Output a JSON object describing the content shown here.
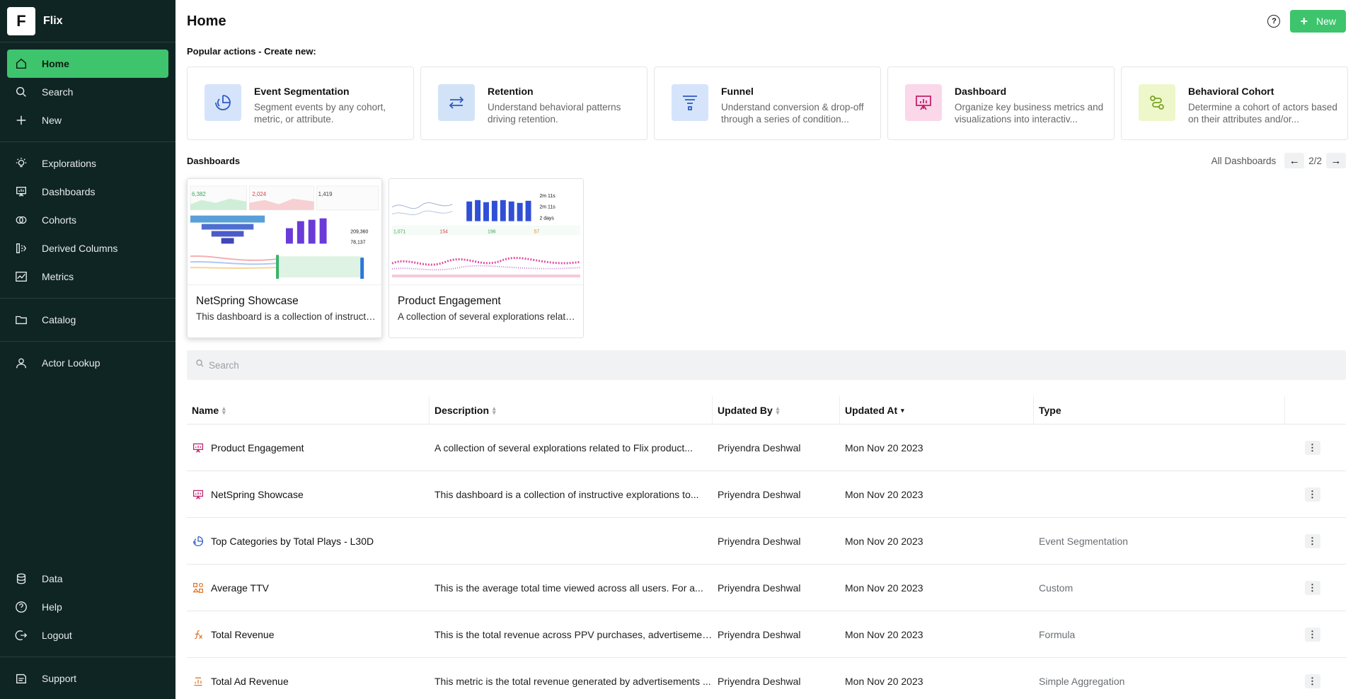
{
  "app": {
    "logo_letter": "F",
    "name": "Flix"
  },
  "sidebar": {
    "primary": [
      {
        "label": "Home",
        "icon": "home-icon",
        "active": true
      },
      {
        "label": "Search",
        "icon": "search-icon"
      },
      {
        "label": "New",
        "icon": "plus-icon"
      }
    ],
    "sections": [
      {
        "label": "Explorations",
        "icon": "lightbulb-icon"
      },
      {
        "label": "Dashboards",
        "icon": "dashboard-icon"
      },
      {
        "label": "Cohorts",
        "icon": "cohorts-icon"
      },
      {
        "label": "Derived Columns",
        "icon": "derived-columns-icon"
      },
      {
        "label": "Metrics",
        "icon": "metrics-icon"
      }
    ],
    "catalog": {
      "label": "Catalog",
      "icon": "folder-icon"
    },
    "actor_lookup": {
      "label": "Actor Lookup",
      "icon": "user-icon"
    },
    "bottom": [
      {
        "label": "Data",
        "icon": "database-icon"
      },
      {
        "label": "Help",
        "icon": "help-icon"
      },
      {
        "label": "Logout",
        "icon": "logout-icon"
      }
    ],
    "support": {
      "label": "Support",
      "icon": "support-icon"
    }
  },
  "header": {
    "title": "Home",
    "help_icon": "?",
    "new_button": "New",
    "new_icon": "+"
  },
  "popular": {
    "label": "Popular actions - Create new:",
    "cards": [
      {
        "title": "Event Segmentation",
        "desc": "Segment events by any cohort, metric, or attribute.",
        "color": "#d6e4fb"
      },
      {
        "title": "Retention",
        "desc": "Understand behavioral patterns driving retention.",
        "color": "#d3e3f7"
      },
      {
        "title": "Funnel",
        "desc": "Understand conversion & drop-off through a series of condition...",
        "color": "#d6e4fb"
      },
      {
        "title": "Dashboard",
        "desc": "Organize key business metrics and visualizations into interactiv...",
        "color": "#fbd7ea"
      },
      {
        "title": "Behavioral Cohort",
        "desc": "Determine a cohort of actors based on their attributes and/or...",
        "color": "#eef7c9"
      }
    ]
  },
  "dashboards": {
    "label": "Dashboards",
    "all_link": "All Dashboards",
    "pager": "2/2",
    "prev": "←",
    "next": "→",
    "cards": [
      {
        "title": "NetSpring Showcase",
        "desc": "This dashboard is a collection of instructive explorations to..."
      },
      {
        "title": "Product Engagement",
        "desc": "A collection of several explorations related to Flix product..."
      }
    ],
    "thumb_numbers": {
      "first": [
        "6,382",
        "2,024",
        "1,419",
        "209,360",
        "78,137"
      ],
      "second": [
        "2m 11s",
        "2m 11s",
        "2 days",
        "1,071",
        "154",
        "196",
        "57"
      ]
    }
  },
  "search": {
    "placeholder": "Search"
  },
  "table": {
    "columns": [
      "Name",
      "Description",
      "Updated By",
      "Updated At",
      "Type"
    ],
    "rows": [
      {
        "name": "Product Engagement",
        "icon": "dashboard-icon",
        "desc": "A collection of several explorations related to Flix product...",
        "by": "Priyendra Deshwal",
        "at": "Mon Nov 20 2023",
        "type": ""
      },
      {
        "name": "NetSpring Showcase",
        "icon": "dashboard-icon",
        "desc": "This dashboard is a collection of instructive explorations to...",
        "by": "Priyendra Deshwal",
        "at": "Mon Nov 20 2023",
        "type": ""
      },
      {
        "name": "Top Categories by Total Plays - L30D",
        "icon": "event-segmentation-icon",
        "desc": "",
        "by": "Priyendra Deshwal",
        "at": "Mon Nov 20 2023",
        "type": "Event Segmentation"
      },
      {
        "name": "Average TTV",
        "icon": "custom-metric-icon",
        "desc": "This is the average total time viewed across all users. For a...",
        "by": "Priyendra Deshwal",
        "at": "Mon Nov 20 2023",
        "type": "Custom"
      },
      {
        "name": "Total Revenue",
        "icon": "formula-icon",
        "desc": "This is the total revenue across PPV purchases, advertisement...",
        "by": "Priyendra Deshwal",
        "at": "Mon Nov 20 2023",
        "type": "Formula"
      },
      {
        "name": "Total Ad Revenue",
        "icon": "aggregation-icon",
        "desc": "This metric is the total revenue generated by advertisements ...",
        "by": "Priyendra Deshwal",
        "at": "Mon Nov 20 2023",
        "type": "Simple Aggregation"
      }
    ],
    "menu_glyph": "⋮"
  }
}
